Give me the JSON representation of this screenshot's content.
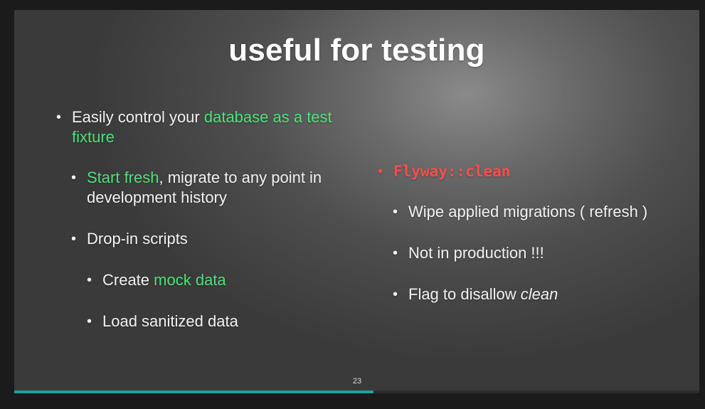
{
  "slide": {
    "title": "useful for testing",
    "page_number": "23",
    "progress_fraction": 0.524,
    "colors": {
      "highlight_green": "#4fe07a",
      "highlight_red": "#ff4d4d",
      "progress": "#17a49a"
    }
  },
  "left_column": {
    "item1": {
      "prefix": "Easily control your ",
      "highlight": "database as a test",
      "line2": "fixture"
    },
    "item2": {
      "highlight": "Start fresh",
      "suffix": ", migrate to any point in",
      "line2": "development history"
    },
    "item3": {
      "text": "Drop-in scripts"
    },
    "item4": {
      "prefix": "Create ",
      "highlight": "mock data"
    },
    "item5": {
      "text": "Load sanitized data"
    }
  },
  "right_column": {
    "heading": "Flyway::clean",
    "item1": "Wipe applied migrations ( refresh )",
    "item2": "Not in production !!!",
    "item3_prefix": "Flag to disallow ",
    "item3_em": "clean"
  },
  "bullet_glyph": "•"
}
